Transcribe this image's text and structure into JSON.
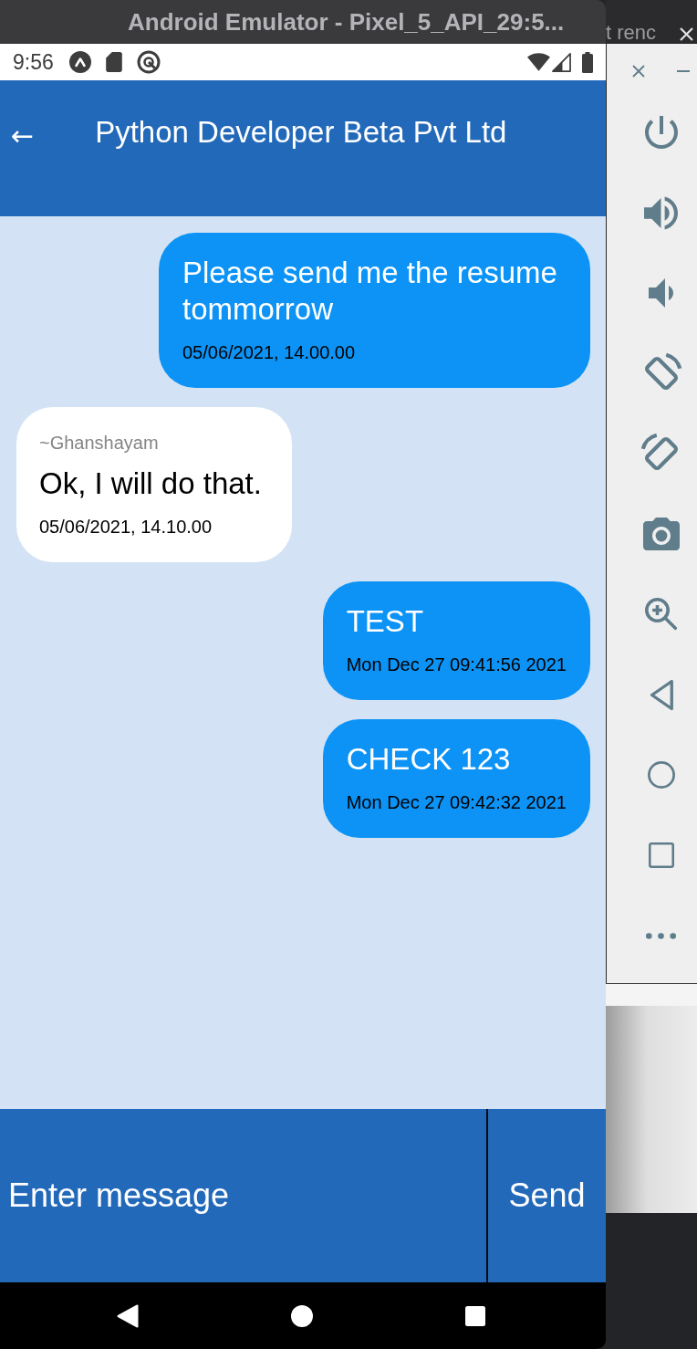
{
  "emulator_window": {
    "title": "Android Emulator - Pixel_5_API_29:5..."
  },
  "background_window": {
    "tab_title": "t renc"
  },
  "status_bar": {
    "time": "9:56"
  },
  "app_bar": {
    "back": "←",
    "title": "Python Developer Beta Pvt Ltd"
  },
  "messages": [
    {
      "kind": "sent",
      "text": "Please send me the resume tommorrow",
      "timestamp": "05/06/2021, 14.00.00"
    },
    {
      "kind": "received",
      "sender": "~Ghanshayam",
      "text": "Ok, I will do that.",
      "timestamp": "05/06/2021, 14.10.00"
    },
    {
      "kind": "sent",
      "text": "TEST",
      "timestamp": "Mon Dec 27 09:41:56 2021"
    },
    {
      "kind": "sent",
      "text": "CHECK 123",
      "timestamp": "Mon Dec 27 09:42:32 2021"
    }
  ],
  "composer": {
    "placeholder": "Enter message",
    "send_button": "Send"
  }
}
